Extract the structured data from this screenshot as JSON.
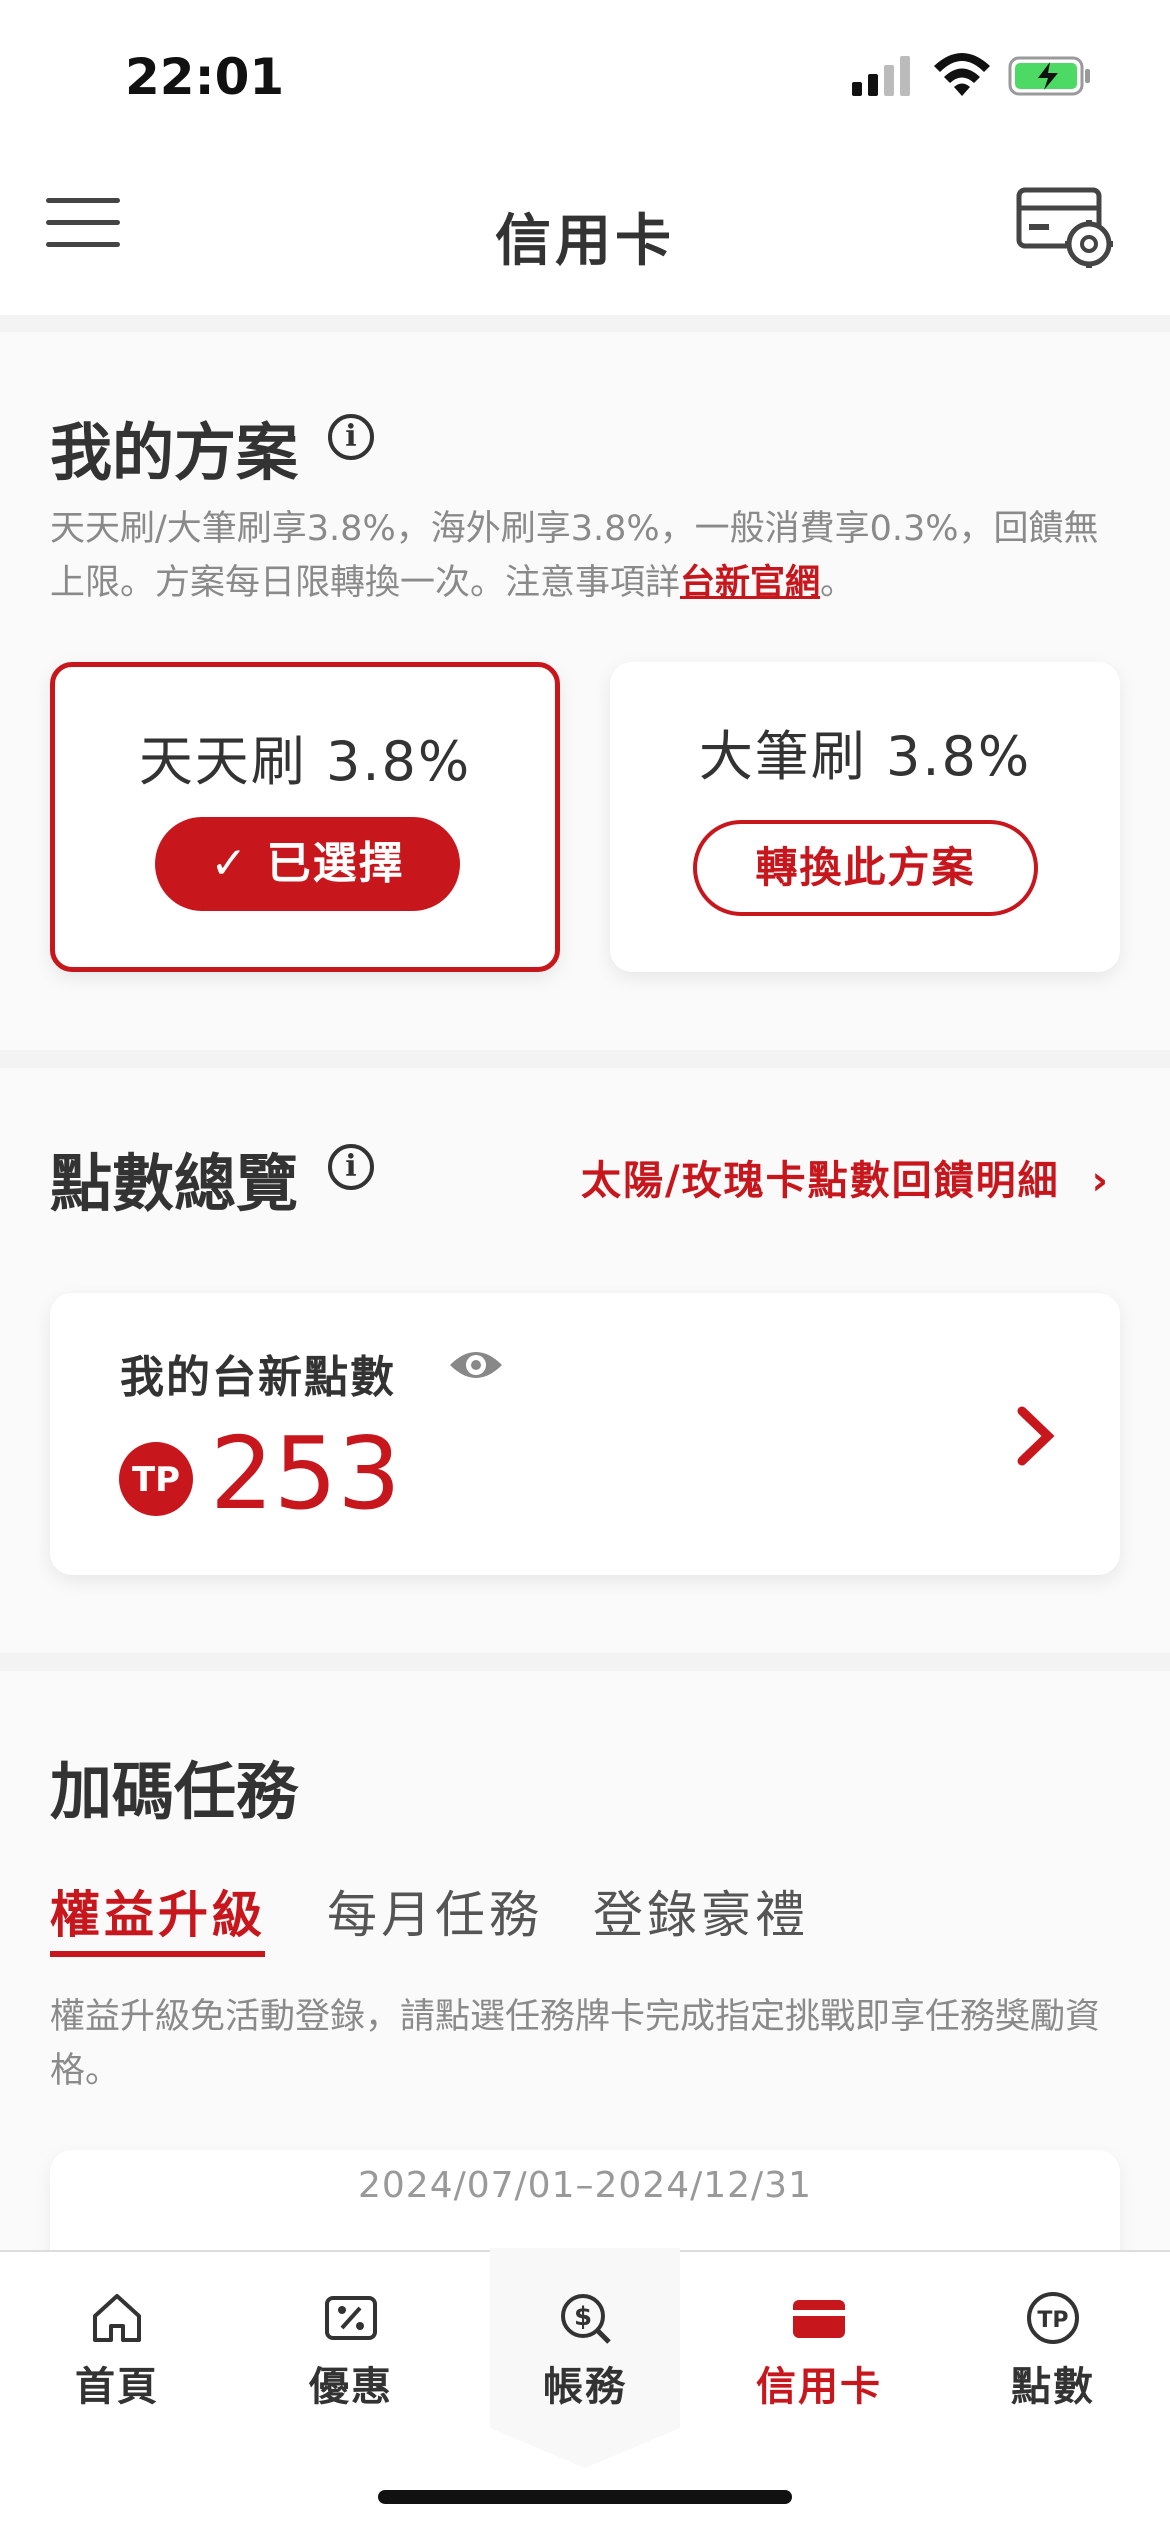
{
  "status_bar": {
    "time": "22:01"
  },
  "header": {
    "title": "信用卡"
  },
  "plan_section": {
    "heading": "我的方案",
    "description": "天天刷/大筆刷享3.8%，海外刷享3.8%，一般消費享0.3%，回饋無上限。方案每日限轉換一次。注意事項詳",
    "link_text": "台新官網",
    "description_end": "。",
    "plans": [
      {
        "name": "天天刷 3.8%",
        "button": "已選擇",
        "selected": true
      },
      {
        "name": "大筆刷 3.8%",
        "button": "轉換此方案",
        "selected": false
      }
    ]
  },
  "points_section": {
    "heading": "點數總覽",
    "detail_link": "太陽/玫瑰卡點數回饋明細",
    "label": "我的台新點數",
    "value": "253"
  },
  "mission_section": {
    "heading": "加碼任務",
    "tabs": [
      "權益升級",
      "每月任務",
      "登錄豪禮"
    ],
    "description": "權益升級免活動登錄，請點選任務牌卡完成指定挑戰即享任務獎勵資格。",
    "date_range": "2024/07/01–2024/12/31"
  },
  "bottom_nav": [
    {
      "label": "首頁",
      "icon": "home-icon"
    },
    {
      "label": "優惠",
      "icon": "percent-icon"
    },
    {
      "label": "帳務",
      "icon": "dollar-search-icon"
    },
    {
      "label": "信用卡",
      "icon": "credit-card-icon"
    },
    {
      "label": "點數",
      "icon": "points-icon"
    }
  ],
  "colors": {
    "accent": "#c8161d"
  }
}
